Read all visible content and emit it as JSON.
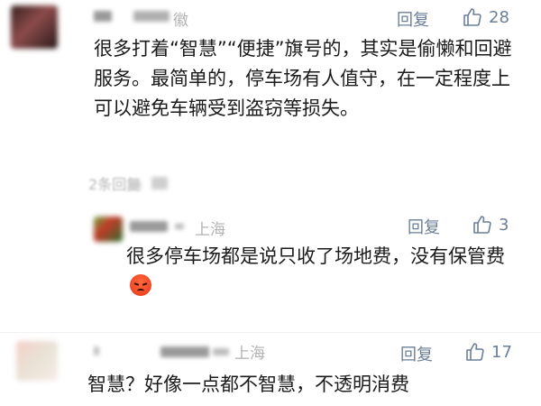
{
  "comments": [
    {
      "location": "徽",
      "reply_label": "回复",
      "like_count": "28",
      "text": "很多打着“智慧”“便捷”旗号的，其实是偷懒和回避服务。最简单的，停车场有人值守，在一定程度上可以避免车辆受到盗窃等损失。",
      "expand_label": "2条回复",
      "replies": [
        {
          "location": "上海",
          "reply_label": "回复",
          "like_count": "3",
          "text": "很多停车场都是说只收了场地费，没有保管费",
          "emoji": "angry-face-emoji"
        }
      ]
    },
    {
      "location": "上海",
      "reply_label": "回复",
      "like_count": "17",
      "text": "智慧？好像一点都不智慧，不透明消费"
    }
  ]
}
